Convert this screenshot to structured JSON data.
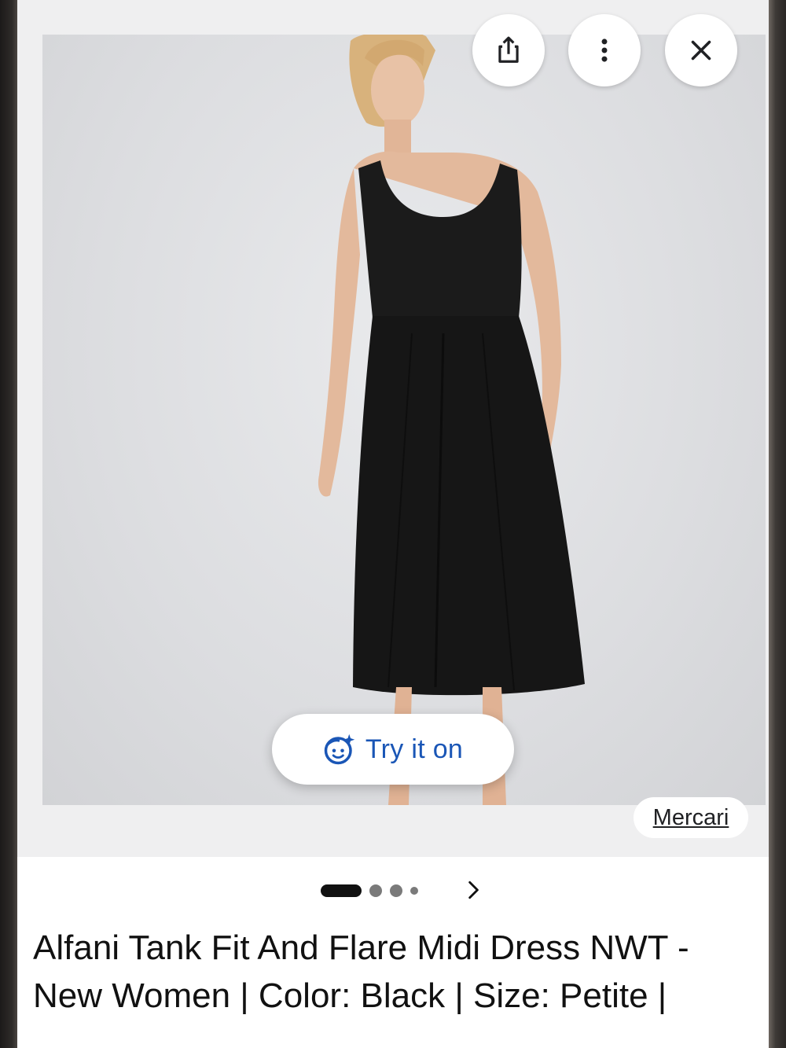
{
  "toolbar": {
    "share_icon": "share-icon",
    "more_icon": "more-vert-icon",
    "close_icon": "close-icon"
  },
  "product_image": {
    "try_on_label": "Try it on",
    "try_on_icon": "face-sparkle-icon",
    "source": "Mercari",
    "accent_color": "#1a56b6"
  },
  "pager": {
    "total": 4,
    "current": 1,
    "next_icon": "chevron-right-icon"
  },
  "product": {
    "title": "Alfani Tank Fit And Flare Midi Dress NWT - New Women | Color: Black | Size: Petite |"
  }
}
